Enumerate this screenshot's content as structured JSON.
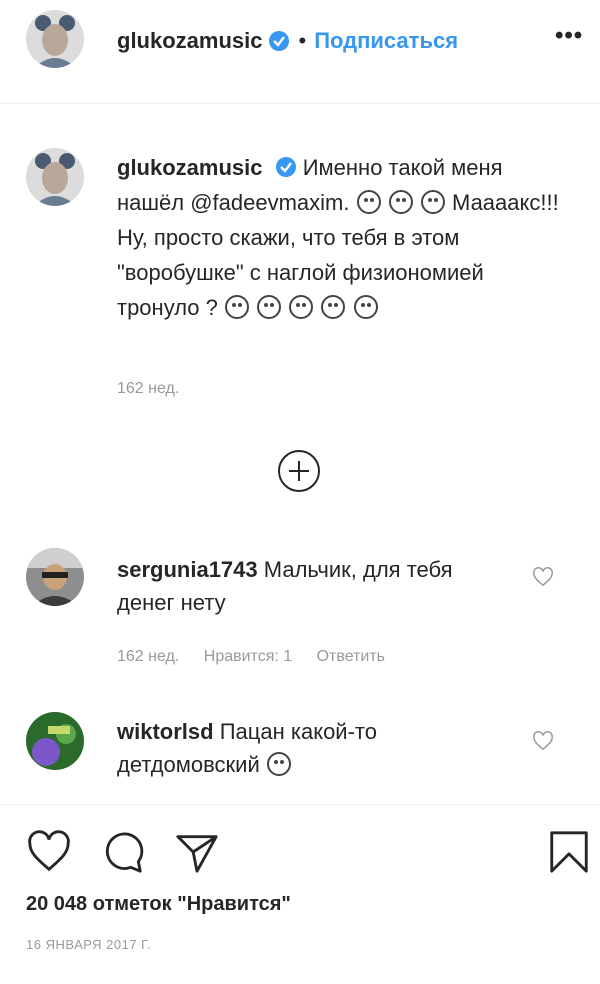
{
  "header": {
    "username": "glukozamusic",
    "separator": "•",
    "follow_label": "Подписаться",
    "more_label": "•••"
  },
  "caption": {
    "username": "glukozamusic",
    "text_part1": "Именно такой меня нашёл @fadeevmaxim.",
    "text_part2": "Маааакс!!! Ну, просто скажи, что тебя в этом \"воробушке\" с наглой физиономией тронуло ?",
    "time": "162 нед."
  },
  "comments": [
    {
      "username": "sergunia1743",
      "text": "Мальчик, для тебя денег нету",
      "time": "162 нед.",
      "likes": "Нравится: 1",
      "reply_label": "Ответить"
    },
    {
      "username": "wiktorlsd",
      "text": "Пацан какой-то детдомовский"
    }
  ],
  "footer": {
    "likes_count": "20 048 отметок \"Нравится\"",
    "date": "16 ЯНВАРЯ 2017 Г."
  },
  "colors": {
    "accent": "#3897f0",
    "text": "#262626",
    "muted": "#999999"
  },
  "icons": [
    "verified-icon",
    "heart-icon",
    "comment-icon",
    "share-icon",
    "bookmark-icon",
    "plus-circle-icon",
    "more-icon"
  ]
}
